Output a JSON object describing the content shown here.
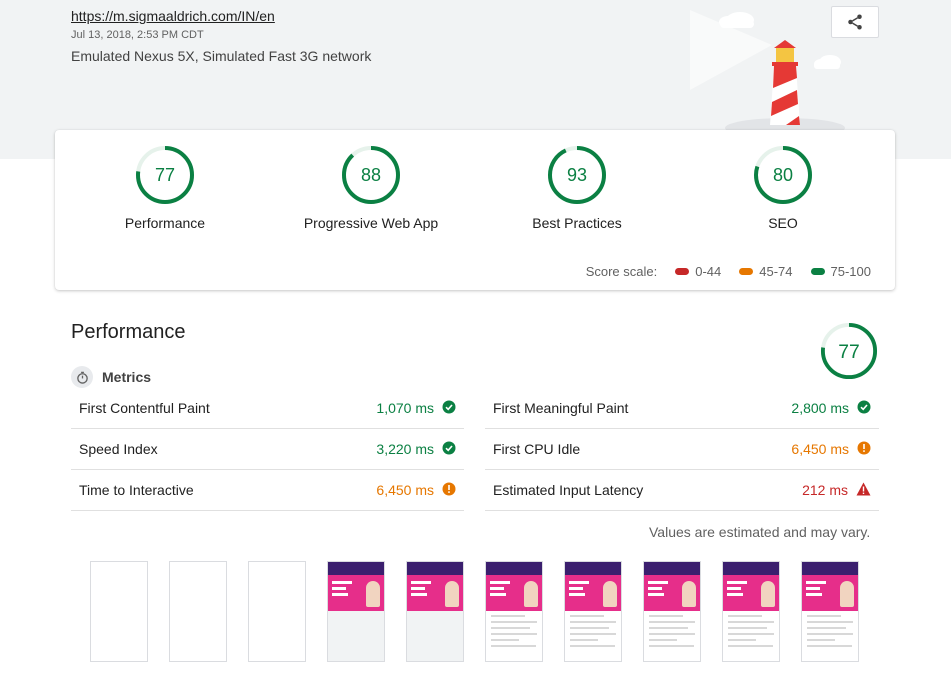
{
  "header": {
    "url": "https://m.sigmaaldrich.com/IN/en",
    "date": "Jul 13, 2018, 2:53 PM CDT",
    "environment": "Emulated Nexus 5X, Simulated Fast 3G network",
    "share_icon": "share-icon"
  },
  "gauges": [
    {
      "label": "Performance",
      "score": "77",
      "value": 77,
      "color": "#0b8043"
    },
    {
      "label": "Progressive Web App",
      "score": "88",
      "value": 88,
      "color": "#0b8043"
    },
    {
      "label": "Best Practices",
      "score": "93",
      "value": 93,
      "color": "#0b8043"
    },
    {
      "label": "SEO",
      "score": "80",
      "value": 80,
      "color": "#0b8043"
    }
  ],
  "score_scale": {
    "label": "Score scale:",
    "ranges": [
      {
        "label": "0-44",
        "color": "#c62828"
      },
      {
        "label": "45-74",
        "color": "#e67700"
      },
      {
        "label": "75-100",
        "color": "#0b8043"
      }
    ]
  },
  "performance": {
    "title": "Performance",
    "score": "77",
    "value": 77,
    "metrics_heading": "Metrics",
    "metrics": [
      {
        "label": "First Contentful Paint",
        "value": "1,070 ms",
        "status": "pass"
      },
      {
        "label": "First Meaningful Paint",
        "value": "2,800 ms",
        "status": "pass"
      },
      {
        "label": "Speed Index",
        "value": "3,220 ms",
        "status": "pass"
      },
      {
        "label": "First CPU Idle",
        "value": "6,450 ms",
        "status": "average"
      },
      {
        "label": "Time to Interactive",
        "value": "6,450 ms",
        "status": "average"
      },
      {
        "label": "Estimated Input Latency",
        "value": "212 ms",
        "status": "fail"
      }
    ],
    "note": "Values are estimated and may vary."
  },
  "filmstrip": {
    "frames": [
      "blank",
      "blank",
      "blank",
      "partial",
      "partial",
      "full",
      "full",
      "full",
      "full",
      "full"
    ]
  }
}
